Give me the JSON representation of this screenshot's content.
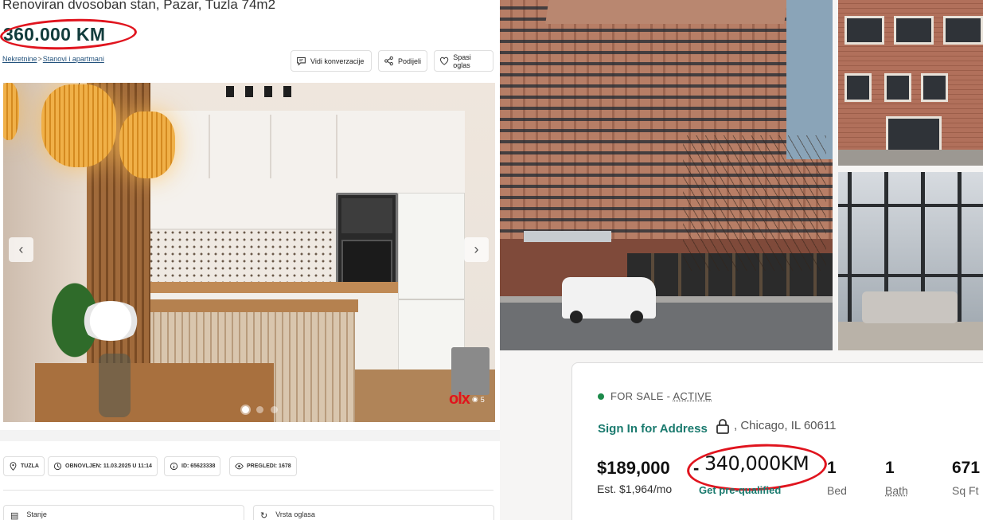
{
  "olx": {
    "title": "Renoviran dvosoban stan, Pazar, Tuzla 74m2",
    "price": "360.000 KM",
    "breadcrumb": [
      "Nekretnine",
      "Stanovi i apartmani"
    ],
    "actions": {
      "conversation": "Vidi konverzacije",
      "share": "Podijeli",
      "save": "Spasi oglas"
    },
    "gallery": {
      "prev_icon": "chevron-left-icon",
      "next_icon": "chevron-right-icon",
      "photo_count": "5",
      "watermark": "olx",
      "slide_index": 0,
      "slide_total": 3
    },
    "chips": {
      "location": "TUZLA",
      "updated": "OBNOVLJEN: 11.03.2025 U 11:14",
      "id": "ID: 65623338",
      "views": "PREGLEDI: 1678"
    },
    "details": {
      "condition_label": "Stanje",
      "listing_type_label": "Vrsta oglasa"
    },
    "highlight_color": "#e0141e"
  },
  "listing": {
    "status_prefix": "FOR SALE - ",
    "status_value": "ACTIVE",
    "sign_in": "Sign In for Address",
    "lock_icon": "lock-icon",
    "location": ", Chicago, IL 60611",
    "price": "$189,000",
    "dash": "-",
    "annotation": "340,000KM",
    "est_payment": "Est. $1,964/mo",
    "prequalified": "Get pre-qualified",
    "beds_value": "1",
    "beds_label": "Bed",
    "baths_value": "1",
    "baths_label": "Bath",
    "sqft_value": "671",
    "sqft_label": "Sq Ft",
    "accent_color": "#1a7a6e",
    "status_color": "#1c8a4a"
  }
}
